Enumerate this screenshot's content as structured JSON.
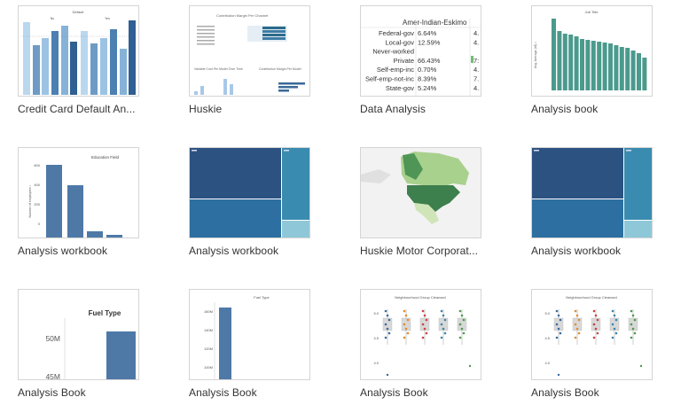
{
  "workbooks": [
    {
      "title": "Credit Card Default An...",
      "thumb": "credit-card-default-bars"
    },
    {
      "title": "Huskie",
      "thumb": "huskie-dashboard"
    },
    {
      "title": "Data Analysis",
      "thumb": "data-analysis-table"
    },
    {
      "title": "Analysis book",
      "thumb": "analysis-book-bars"
    },
    {
      "title": "Analysis workbook",
      "thumb": "education-field-bars"
    },
    {
      "title": "Analysis workbook",
      "thumb": "treemap-blue"
    },
    {
      "title": "Huskie Motor Corporat...",
      "thumb": "north-america-map"
    },
    {
      "title": "Analysis workbook",
      "thumb": "treemap-blue"
    },
    {
      "title": "Analysis Book",
      "thumb": "fuel-type-bar"
    },
    {
      "title": "Analysis Book",
      "thumb": "fuel-type-bar-tall"
    },
    {
      "title": "Analysis Book",
      "thumb": "neighbourhood-boxplot"
    },
    {
      "title": "Analysis Book",
      "thumb": "neighbourhood-boxplot"
    }
  ],
  "thumb_text": {
    "credit_default_title": "Default",
    "credit_no": "No",
    "credit_yes": "Yes",
    "huskie_title": "Contribution Margin Per Channel",
    "huskie_subtitle": "Variable Cost Per Model Over Time",
    "huskie_model": "Contribution Margin Per Model",
    "analysis_rows": [
      {
        "label": "Federal-gov",
        "value": "6.64%"
      },
      {
        "label": "Local-gov",
        "value": "12.59%"
      },
      {
        "label": "Never-worked",
        "value": ""
      },
      {
        "label": "Private",
        "value": "66.43%"
      },
      {
        "label": "Self-emp-inc",
        "value": "0.70%"
      },
      {
        "label": "Self-emp-not-inc",
        "value": "8.39%"
      },
      {
        "label": "State-gov",
        "value": "5.24%"
      }
    ],
    "analysis_col_header": "Amer-Indian-Eskimo",
    "analysis_col2_values": [
      "4.",
      "4.",
      "",
      "7:",
      "4.",
      "7.",
      "4."
    ],
    "job_title": "Job Title",
    "job_ylabel": "Avg. Average (k$) ↑",
    "edu_title": "Education Field",
    "edu_ylabel": "Number of employees ↑",
    "edu_ticks": [
      "600",
      "400",
      "200",
      "0"
    ],
    "fuel_title": "Fuel Type",
    "fuel_ticks_a": [
      "50M",
      "45M"
    ],
    "fuel_ticks_b": [
      "160M",
      "140M",
      "120M",
      "100M"
    ],
    "neigh_title": "Neighbourhood Group Cleansed",
    "neigh_ticks": [
      "5.0",
      "4.5",
      "4.0"
    ]
  }
}
